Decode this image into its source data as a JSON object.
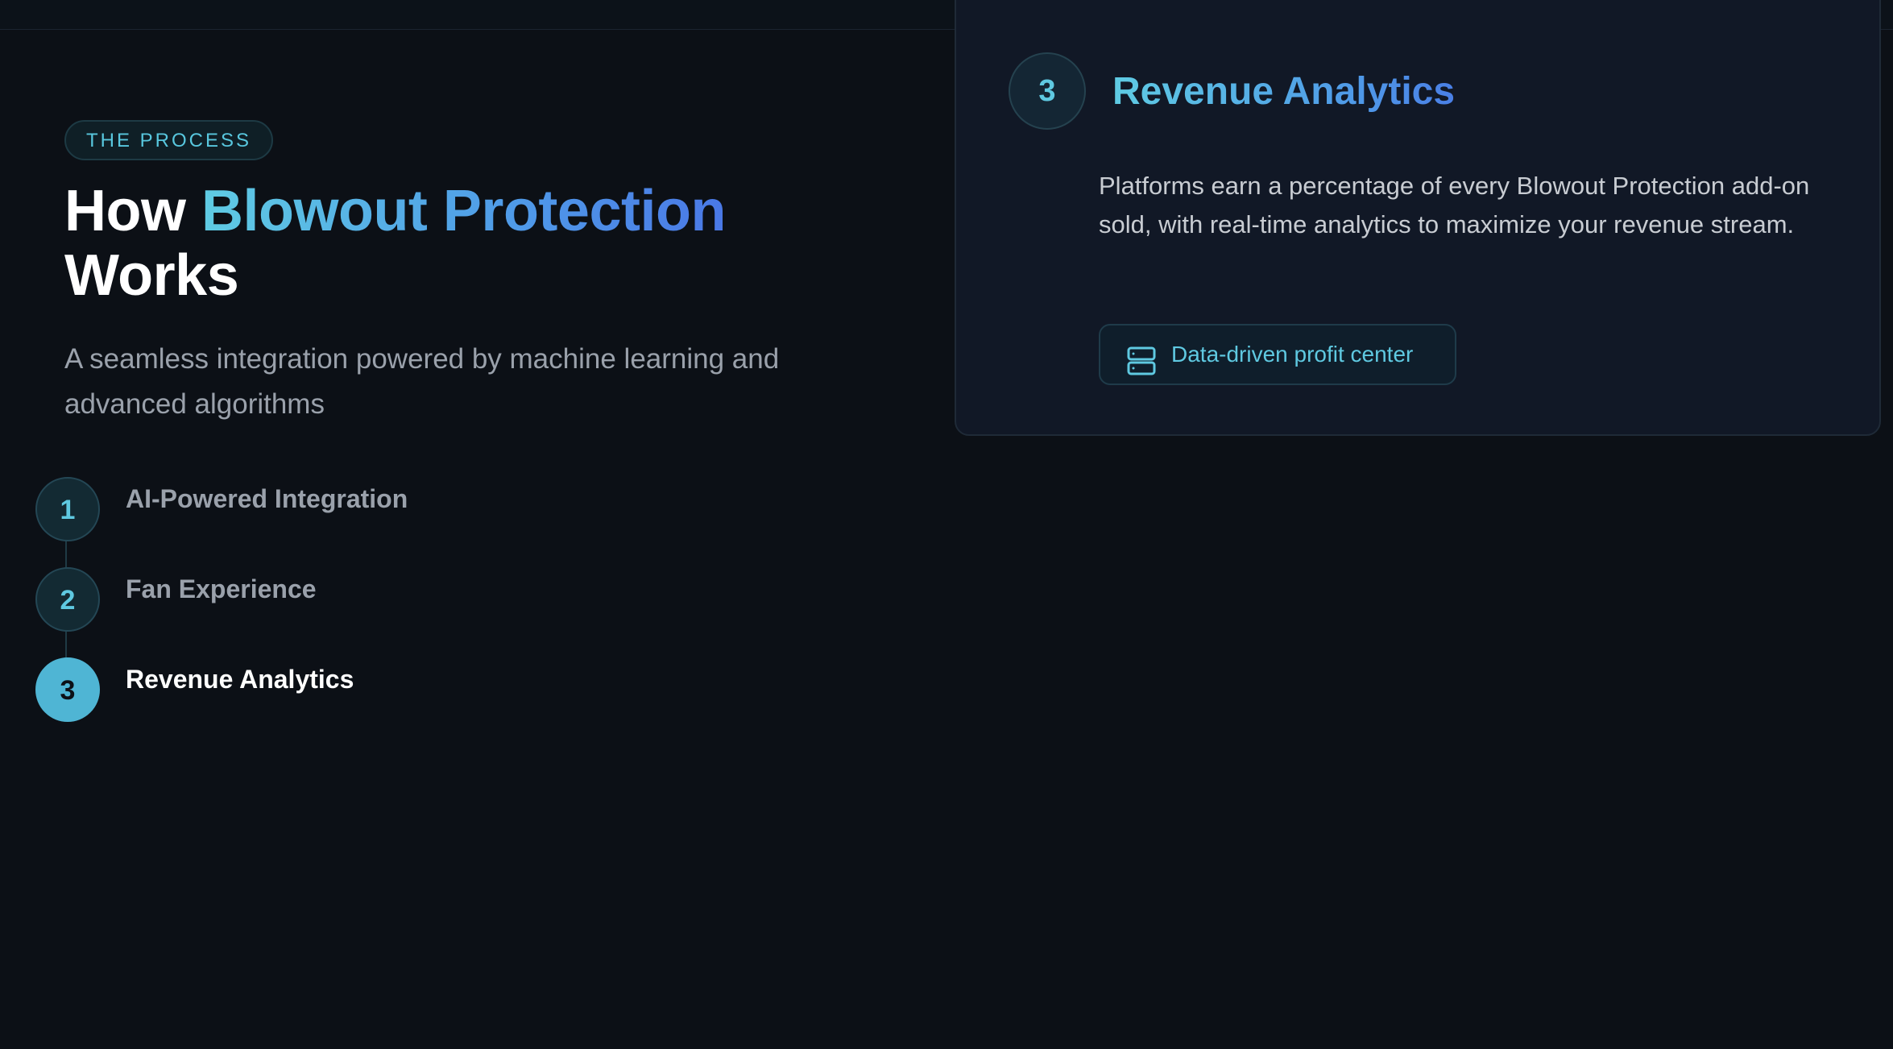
{
  "badge": "THE PROCESS",
  "headline": {
    "prefix": "How ",
    "highlight": "Blowout Protection",
    "suffix": "Works"
  },
  "subtitle": "A seamless integration powered by machine learning and advanced algorithms",
  "steps": [
    {
      "number": "1",
      "label": "AI-Powered Integration",
      "active": false
    },
    {
      "number": "2",
      "label": "Fan Experience",
      "active": false
    },
    {
      "number": "3",
      "label": "Revenue Analytics",
      "active": true
    }
  ],
  "card": {
    "number": "3",
    "title": "Revenue Analytics",
    "description": "Platforms earn a percentage of every Blowout Protection add-on sold, with real-time analytics to maximize your revenue stream.",
    "chip_label": "Data-driven profit center",
    "chip_icon": "server-icon"
  },
  "colors": {
    "background": "#0c1016",
    "accent": "#5fc9e1",
    "gradient_end": "#4a78e6",
    "active_step": "#4fb5d4"
  }
}
